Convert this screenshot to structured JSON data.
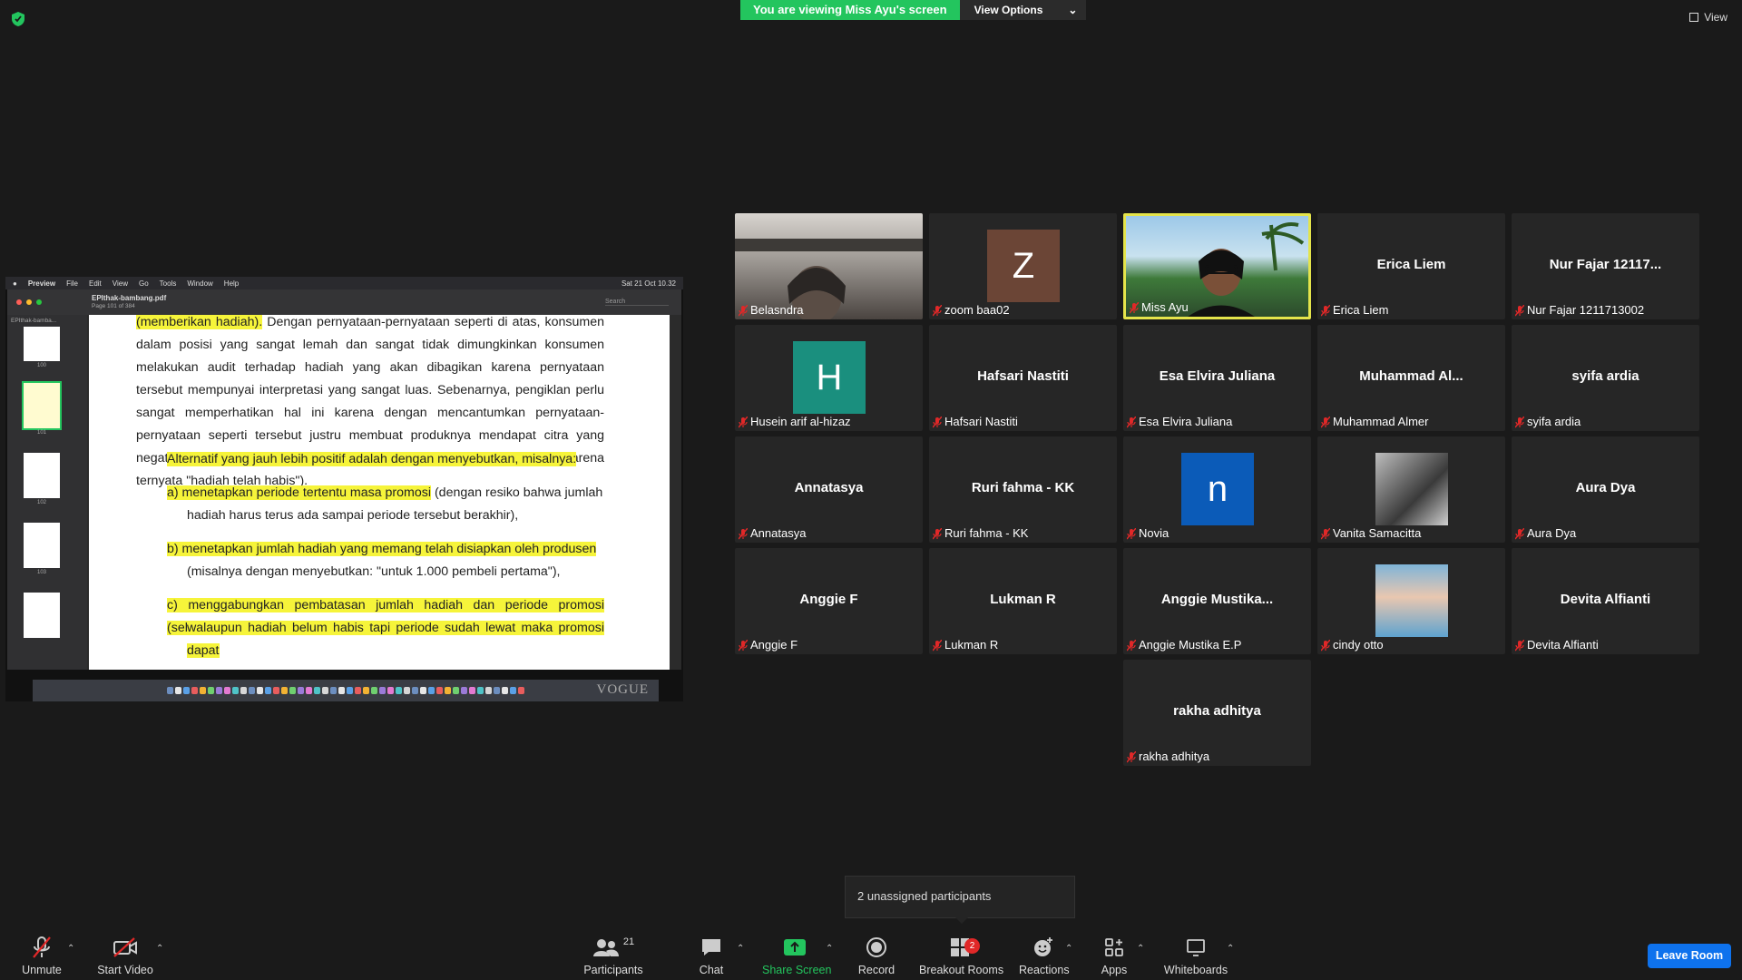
{
  "banner": {
    "viewing_text": "You are viewing Miss Ayu's screen",
    "view_options": "View Options"
  },
  "view_button": "View",
  "shared_screen": {
    "menu": [
      "Preview",
      "File",
      "Edit",
      "View",
      "Go",
      "Tools",
      "Window",
      "Help"
    ],
    "clock": "Sat 21 Oct 10.32",
    "file_name": "EPIthak-bambang.pdf",
    "page_info": "Page 101 of 384",
    "search_placeholder": "Search",
    "sidebar_title": "EPIthak-bamba...",
    "thumb_labels": [
      "100",
      "101",
      "102",
      "103"
    ],
    "paragraphs": {
      "p1_hl": "(memberikan hadiah).",
      "p1_rest": " Dengan pernyataan-pernyataan seperti di atas, konsumen dalam posisi yang sangat lemah dan sangat tidak dimungkinkan konsumen melakukan audit terhadap hadiah yang akan dibagikan karena pernyataan tersebut mempunyai interpretasi yang sangat luas. Sebenarnya, pengiklan perlu sangat memperhatikan hal ini karena dengan mencantumkan pernyataan-pernyataan seperti tersebut justru membuat produknya mendapat citra yang negatif dari konsumen (apalagi bila kemudian konsumen dikecewakan karena ternyata \"hadiah telah habis\").",
      "p2": "Alternatif yang jauh lebih positif adalah dengan menyebutkan, misalnya:",
      "a_hl": "a) menetapkan periode tertentu masa promosi",
      "a_rest": " (dengan resiko bahwa jumlah",
      "a_line2": "hadiah harus terus ada sampai periode tersebut berakhir),",
      "b_hl": "b) menetapkan jumlah hadiah yang memang telah disiapkan oleh produsen",
      "b_line2": "(misalnya dengan menyebutkan: \"untuk 1.000 pembeli pertama\"),",
      "c_hl": "c) menggabungkan pembatasan jumlah hadiah dan periode promosi (sehingga",
      "c_line2": "walaupun hadiah belum habis tapi periode sudah lewat maka promosi dapat"
    },
    "dock_brand": "VOGUE"
  },
  "participants": [
    {
      "display": "",
      "name": "Belasndra",
      "type": "video"
    },
    {
      "display": "Z",
      "name": "zoom baa02",
      "type": "avatar",
      "color": "#6b4536"
    },
    {
      "display": "",
      "name": "Miss Ayu",
      "type": "video",
      "active": true
    },
    {
      "display": "Erica Liem",
      "name": "Erica Liem",
      "type": "name"
    },
    {
      "display": "Nur Fajar 12117...",
      "name": "Nur Fajar 1211713002",
      "type": "name"
    },
    {
      "display": "H",
      "name": "Husein arif al-hizaz",
      "type": "avatar",
      "color": "#1a8f7e"
    },
    {
      "display": "Hafsari Nastiti",
      "name": "Hafsari Nastiti",
      "type": "name"
    },
    {
      "display": "Esa Elvira Juliana",
      "name": "Esa Elvira Juliana",
      "type": "name"
    },
    {
      "display": "Muhammad  Al...",
      "name": "Muhammad Almer",
      "type": "name"
    },
    {
      "display": "syifa ardia",
      "name": "syifa ardia",
      "type": "name"
    },
    {
      "display": "Annatasya",
      "name": "Annatasya",
      "type": "name"
    },
    {
      "display": "Ruri fahma - KK",
      "name": "Ruri fahma - KK",
      "type": "name"
    },
    {
      "display": "n",
      "name": "Novia",
      "type": "avatar",
      "color": "#0b5bb8"
    },
    {
      "display": "",
      "name": "Vanita Samacitta",
      "type": "photo"
    },
    {
      "display": "Aura Dya",
      "name": "Aura Dya",
      "type": "name"
    },
    {
      "display": "Anggie F",
      "name": "Anggie F",
      "type": "name"
    },
    {
      "display": "Lukman R",
      "name": "Lukman R",
      "type": "name"
    },
    {
      "display": "Anggie  Mustika...",
      "name": "Anggie Mustika E.P",
      "type": "name"
    },
    {
      "display": "",
      "name": "cindy otto",
      "type": "photo2"
    },
    {
      "display": "Devita Alfianti",
      "name": "Devita Alfianti",
      "type": "name"
    },
    {
      "display": "rakha adhitya",
      "name": "rakha adhitya",
      "type": "name"
    }
  ],
  "toast": "2 unassigned participants",
  "toolbar": {
    "unmute": "Unmute",
    "start_video": "Start Video",
    "participants": "Participants",
    "participants_count": "21",
    "chat": "Chat",
    "share_screen": "Share Screen",
    "record": "Record",
    "breakout_rooms": "Breakout Rooms",
    "breakout_badge": "2",
    "reactions": "Reactions",
    "apps": "Apps",
    "whiteboards": "Whiteboards",
    "leave": "Leave Room"
  },
  "colors": {
    "accent_green": "#23c55e",
    "leave_blue": "#0e72ed",
    "highlight_yellow": "#f6f43a",
    "active_border": "#e4e44b"
  }
}
